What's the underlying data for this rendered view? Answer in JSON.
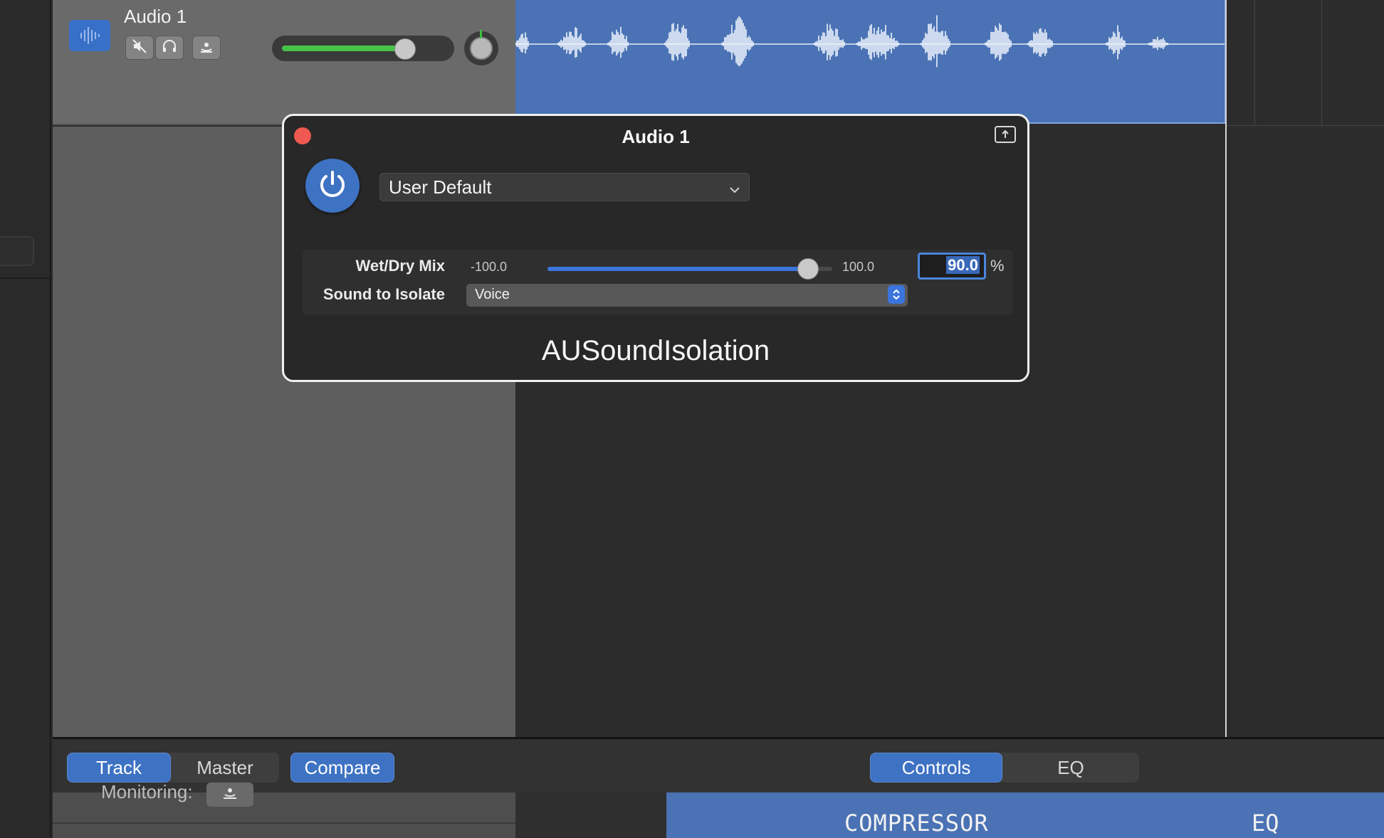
{
  "track": {
    "name": "Audio 1",
    "volume_level": 0.82
  },
  "plugin": {
    "window_title": "Audio 1",
    "preset": "User Default",
    "wet_dry": {
      "label": "Wet/Dry Mix",
      "min": "-100.0",
      "max": "100.0",
      "value": "90.0",
      "unit": "%",
      "fraction": 0.95
    },
    "sound_to_isolate": {
      "label": "Sound to Isolate",
      "value": "Voice"
    },
    "name": "AUSoundIsolation"
  },
  "bottom_bar": {
    "track_label": "Track",
    "master_label": "Master",
    "compare_label": "Compare",
    "controls_label": "Controls",
    "eq_label": "EQ"
  },
  "bottom_panel": {
    "monitoring_label": "Monitoring:",
    "compressor_label": "COMPRESSOR",
    "eq_label": "EQ"
  },
  "colors": {
    "accent": "#3e72c2",
    "region": "#4a72b4",
    "close": "#ee5a51",
    "volume": "#49c24a"
  }
}
